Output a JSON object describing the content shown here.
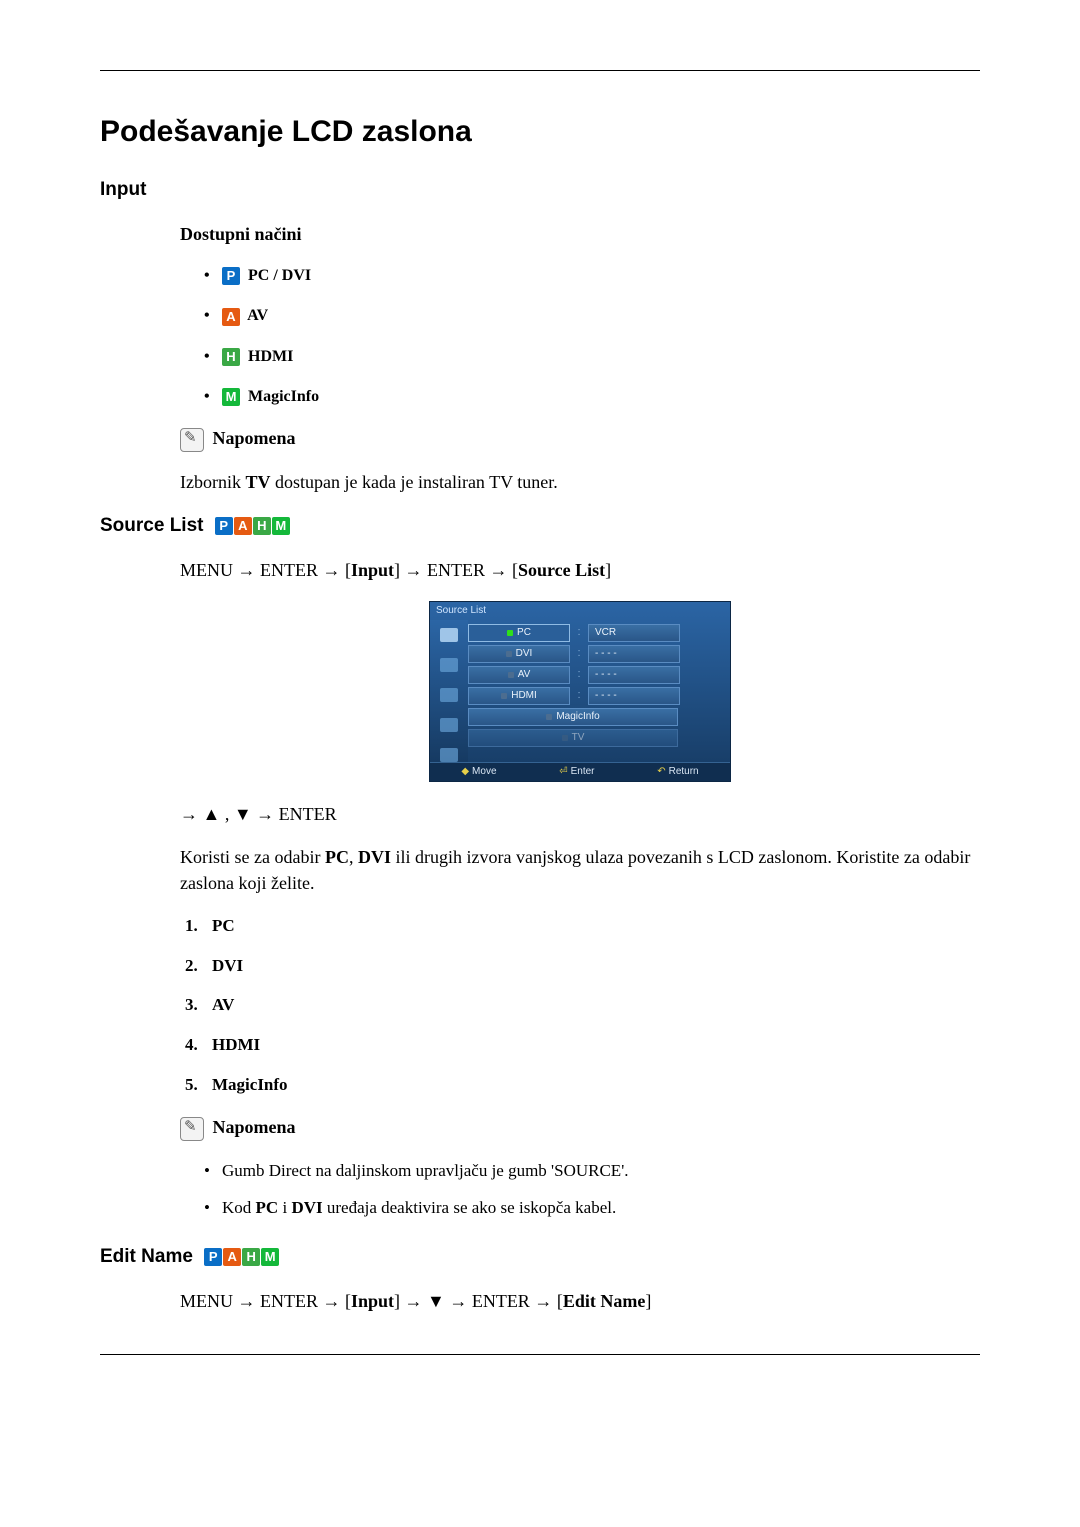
{
  "title": "Podešavanje LCD zaslona",
  "input_section": {
    "heading": "Input",
    "available_modes_heading": "Dostupni načini",
    "modes": {
      "pc_dvi": "PC / DVI",
      "av": "AV",
      "hdmi": "HDMI",
      "magicinfo": "MagicInfo"
    },
    "note_label": "Napomena",
    "note_text_prefix": "Izbornik ",
    "note_text_bold": "TV",
    "note_text_suffix": " dostupan je kada je instaliran TV tuner."
  },
  "source_list": {
    "heading": "Source List",
    "path_prefix": "MENU → ENTER → [",
    "path_input": "Input",
    "path_mid": "] → ENTER → [",
    "path_target": "Source List",
    "path_suffix": "]",
    "nav_line_prefix": "→ ▲ , ▼ → ENTER",
    "desc_prefix": "Koristi se za odabir ",
    "desc_pc": "PC",
    "desc_sep1": ", ",
    "desc_dvi": "DVI",
    "desc_suffix": " ili drugih izvora vanjskog ulaza povezanih s LCD zaslonom. Koristite za odabir zaslona koji želite.",
    "items": {
      "1": "PC",
      "2": "DVI",
      "3": "AV",
      "4": "HDMI",
      "5": "MagicInfo"
    },
    "note_label": "Napomena",
    "note_bullets": {
      "0": "Gumb Direct na daljinskom upravljaču je gumb 'SOURCE'.",
      "1_prefix": "Kod  ",
      "1_pc": "PC",
      "1_mid": " i ",
      "1_dvi": "DVI",
      "1_suffix": " uređaja deaktivira se ako se iskopča kabel."
    }
  },
  "osd": {
    "title": "Source List",
    "rows": {
      "pc": {
        "left": "PC",
        "right": "VCR"
      },
      "dvi": {
        "left": "DVI",
        "right": "- - - -"
      },
      "av": {
        "left": "AV",
        "right": "- - - -"
      },
      "hdmi": {
        "left": "HDMI",
        "right": "- - - -"
      },
      "magicinfo": {
        "left": "MagicInfo",
        "right": ""
      },
      "tv": {
        "left": "TV",
        "right": ""
      }
    },
    "footer": {
      "move": "Move",
      "enter": "Enter",
      "return": "Return"
    }
  },
  "edit_name": {
    "heading": "Edit Name",
    "path_prefix": "MENU → ENTER → [",
    "path_input": "Input",
    "path_mid": "] → ▼ → ENTER → [",
    "path_target": "Edit Name",
    "path_suffix": "]"
  }
}
